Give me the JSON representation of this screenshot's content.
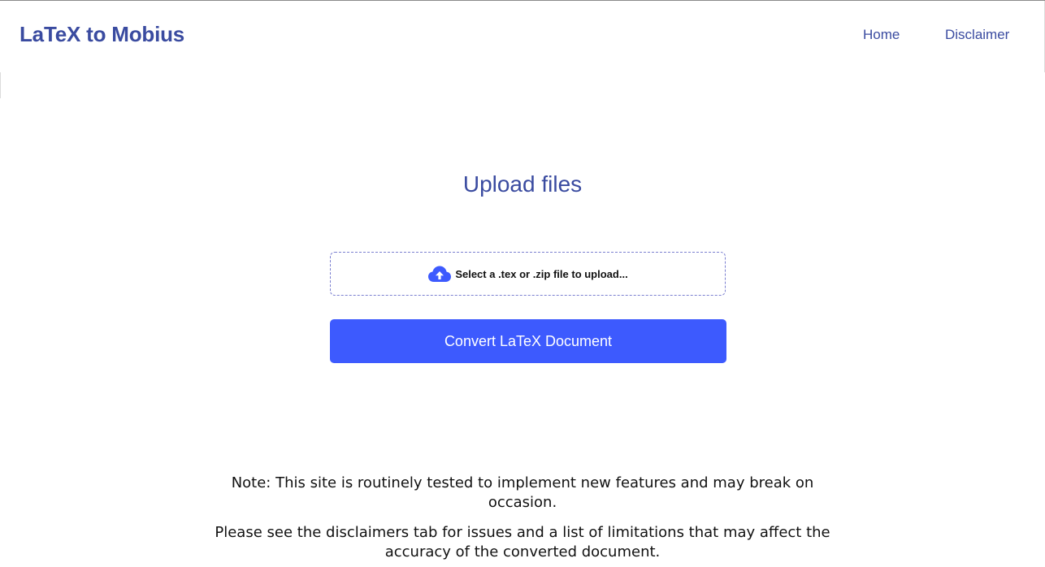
{
  "navbar": {
    "brand": "LaTeX to Mobius",
    "links": [
      {
        "label": "Home"
      },
      {
        "label": "Disclaimer"
      }
    ],
    "accent_color": "#3a4ba0"
  },
  "main": {
    "title": "Upload files",
    "dropzone": {
      "label": "Select a .tex or .zip file to upload...",
      "icon": "cloud-upload-icon"
    },
    "convert_button": {
      "label": "Convert LaTeX Document",
      "color": "#3d5afe"
    }
  },
  "notes": {
    "note1_line1": "Note: This site is routinely tested to implement new features and may break on",
    "note1_line2": "occasion.",
    "note2_line1": "Please see the disclaimers tab for issues and a list of limitations that may affect the",
    "note2_line2": "accuracy of the converted document."
  }
}
